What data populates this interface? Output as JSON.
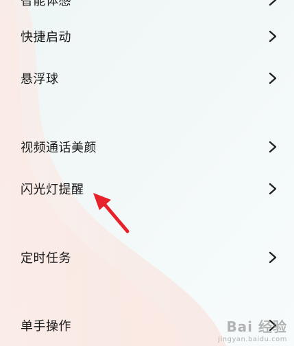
{
  "menu": {
    "items": [
      {
        "label": "智能体感"
      },
      {
        "label": "快捷启动"
      },
      {
        "label": "悬浮球"
      },
      {
        "label": "视频通话美颜"
      },
      {
        "label": "闪光灯提醒"
      },
      {
        "label": "定时任务"
      },
      {
        "label": "单手操作"
      }
    ]
  },
  "icons": {
    "chevron": "chevron-right-icon",
    "annotation": "red-arrow-icon"
  },
  "watermark": {
    "main": "Bai 经验",
    "sub": "jingyan.baidu.com"
  },
  "colors": {
    "text": "#1a1a1a",
    "chevron": "#222222",
    "annotation_arrow": "#e8222a",
    "background": "#f4f9fa"
  }
}
